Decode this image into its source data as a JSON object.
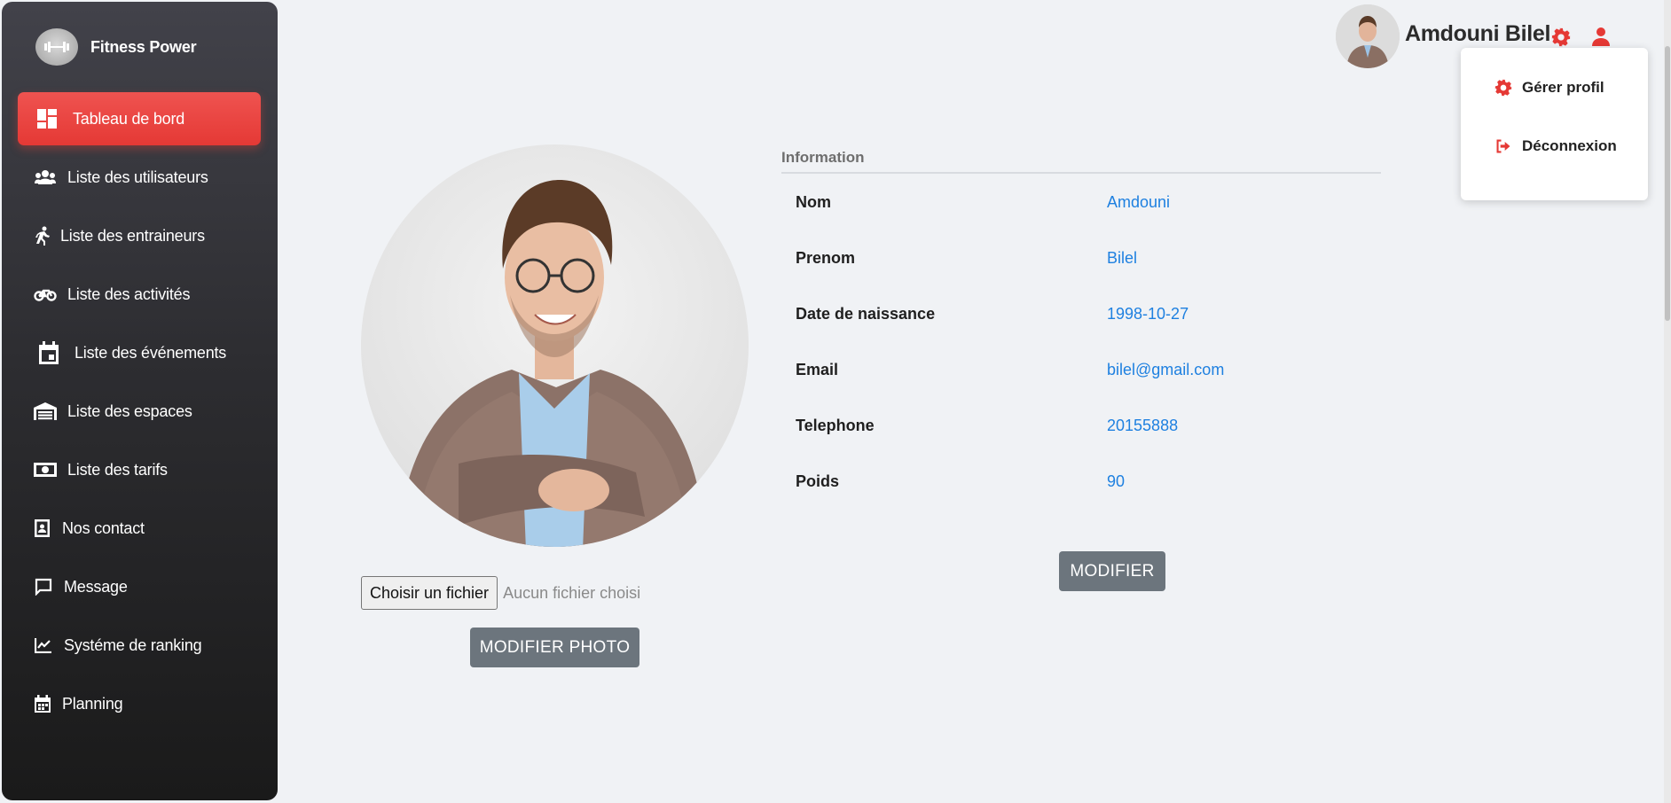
{
  "brand": {
    "name": "Fitness Power",
    "icon": "dumbbell-icon"
  },
  "sidebar": {
    "items": [
      {
        "label": "Tableau de bord",
        "icon": "dashboard-icon",
        "active": true
      },
      {
        "label": "Liste des utilisateurs",
        "icon": "users-icon"
      },
      {
        "label": "Liste des entraineurs",
        "icon": "running-icon"
      },
      {
        "label": "Liste des activités",
        "icon": "bicycle-icon"
      },
      {
        "label": "Liste des événements",
        "icon": "calendar-event-icon"
      },
      {
        "label": "Liste des espaces",
        "icon": "warehouse-icon"
      },
      {
        "label": "Liste des tarifs",
        "icon": "money-bill-icon"
      },
      {
        "label": "Nos contact",
        "icon": "address-book-icon"
      },
      {
        "label": "Message",
        "icon": "message-icon"
      },
      {
        "label": "Systéme de ranking",
        "icon": "chart-line-icon"
      },
      {
        "label": "Planning",
        "icon": "calendar-icon"
      }
    ]
  },
  "header": {
    "user_name": "Amdouni Bilel",
    "settings_icon": "gear-icon",
    "user_icon": "user-icon"
  },
  "dropdown": {
    "items": [
      {
        "label": "Gérer profil",
        "icon": "gear-icon"
      },
      {
        "label": "Déconnexion",
        "icon": "sign-out-icon"
      }
    ]
  },
  "photo_section": {
    "file_button": "Choisir un fichier",
    "file_status": "Aucun fichier choisi",
    "modify_photo": "MODIFIER PHOTO"
  },
  "info": {
    "heading": "Information",
    "rows": [
      {
        "label": "Nom",
        "value": "Amdouni"
      },
      {
        "label": "Prenom",
        "value": "Bilel"
      },
      {
        "label": "Date de naissance",
        "value": "1998-10-27"
      },
      {
        "label": "Email",
        "value": "bilel@gmail.com"
      },
      {
        "label": "Telephone",
        "value": "20155888"
      },
      {
        "label": "Poids",
        "value": "90"
      }
    ],
    "modify_button": "MODIFIER"
  },
  "colors": {
    "accent": "#e53935",
    "link": "#1e80e0",
    "button": "#6c757d"
  }
}
